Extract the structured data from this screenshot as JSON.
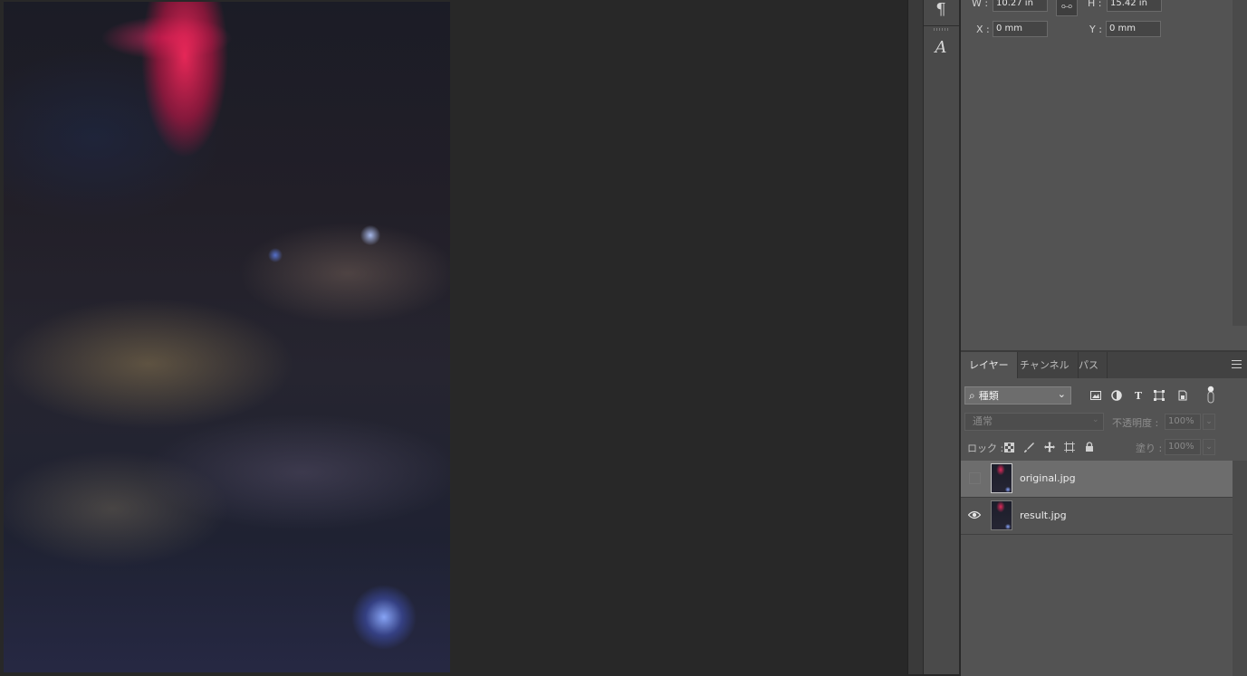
{
  "app": "Photoshop",
  "tool_strip": {
    "paragraph_glyph": "¶",
    "character_glyph": "A"
  },
  "properties": {
    "w_label": "W :",
    "w_value": "10.27 in",
    "h_label": "H :",
    "h_value": "15.42 in",
    "x_label": "X :",
    "x_value": "0 mm",
    "y_label": "Y :",
    "y_value": "0 mm",
    "link_icon": "link-icon"
  },
  "layers_panel": {
    "tabs": [
      {
        "label": "レイヤー",
        "active": true
      },
      {
        "label": "チャンネル",
        "active": false
      },
      {
        "label": "パス",
        "active": false
      }
    ],
    "filter": {
      "search_glyph": "⌕",
      "label": "種類",
      "chevron": "⌄"
    },
    "filter_icons": [
      "image-icon",
      "adjustment-icon",
      "type-icon",
      "shape-icon",
      "smart-object-icon"
    ],
    "filter_type_glyph": "T",
    "blend_mode": "通常",
    "opacity_label": "不透明度 :",
    "opacity_value": "100%",
    "lock_label": "ロック :",
    "fill_label": "塗り :",
    "fill_value": "100%",
    "layers": [
      {
        "name": "original.jpg",
        "visible": false,
        "selected": true
      },
      {
        "name": "result.jpg",
        "visible": true,
        "selected": false
      }
    ]
  },
  "colors": {
    "canvas_bg": "#282828",
    "panel_bg": "#535353",
    "selected_row": "#6d6d6d"
  }
}
